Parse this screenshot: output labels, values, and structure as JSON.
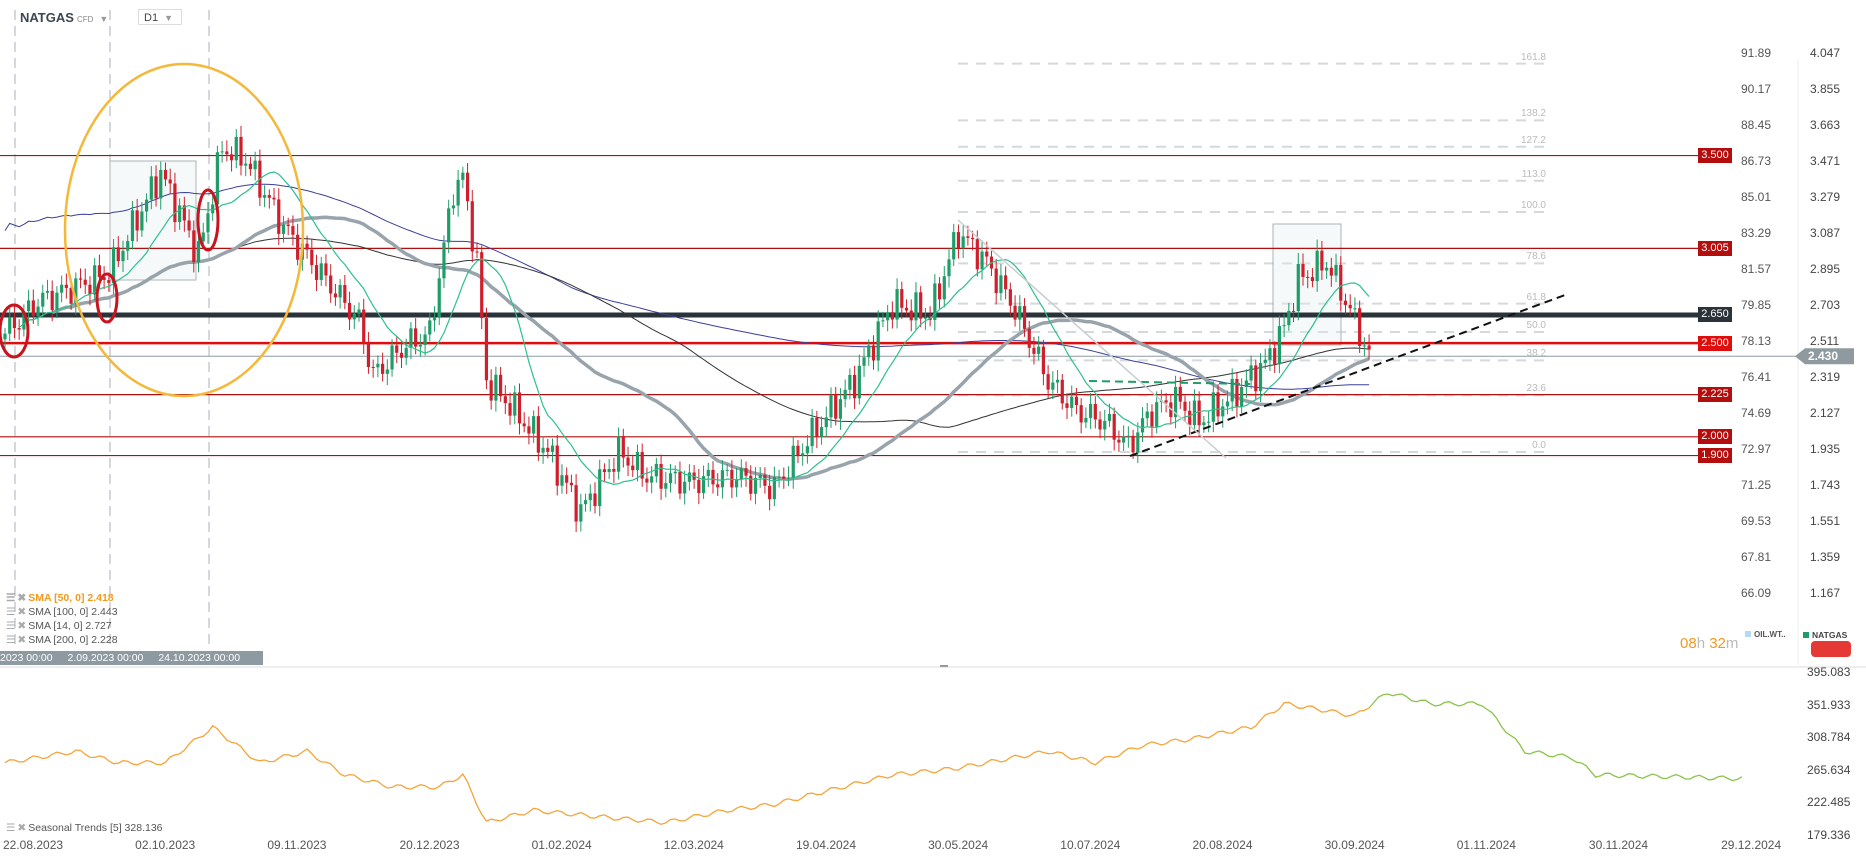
{
  "header": {
    "symbol": "NATGAS",
    "symbol_type": "CFD",
    "timeframe": "D1"
  },
  "colors": {
    "up": "#1f9c68",
    "down": "#d01f2c",
    "level_red": "#b30d0d",
    "level_2500": "#e00d0d",
    "level_2650": "#2a333a",
    "sma14": "#2cc08c",
    "sma50": "#98a3ab",
    "sma100": "#333333",
    "sma200": "#3b3f9a",
    "seasonal_past": "#f5a43a",
    "seasonal_future": "#8bc34a",
    "ellipse": "#f4b83a"
  },
  "indicators": [
    {
      "label": "SMA [50, 0] 2.418",
      "highlight": true
    },
    {
      "label": "SMA [100, 0] 2.443"
    },
    {
      "label": "SMA [14, 0] 2.727"
    },
    {
      "label": "SMA [200, 0] 2.228"
    }
  ],
  "crosshair_dates": [
    "2023 00:00",
    "2.09.2023 00:00",
    "24.10.2023 00:00"
  ],
  "timer": {
    "hours": "08",
    "h": "h",
    "minutes": "32",
    "m": "m"
  },
  "series_legend": [
    {
      "label": "OIL.WT..",
      "color": "#b3dcf2"
    },
    {
      "label": "NATGAS",
      "color": "#1f9c68"
    }
  ],
  "seasonal_label": "Seasonal  Trends  [5]  328.136",
  "chart_data": {
    "type": "candlestick",
    "title": "NATGAS CFD D1",
    "x_ticks": [
      "22.08.2023",
      "02.10.2023",
      "09.11.2023",
      "20.12.2023",
      "01.02.2024",
      "12.03.2024",
      "19.04.2024",
      "30.05.2024",
      "10.07.2024",
      "20.08.2024",
      "30.09.2024",
      "01.11.2024",
      "30.11.2024",
      "29.12.2024"
    ],
    "bars_per_tick": 28,
    "right_axis": {
      "ticks": [
        "4.047",
        "3.855",
        "3.663",
        "3.471",
        "3.279",
        "3.087",
        "2.895",
        "2.703",
        "2.511",
        "2.319",
        "2.127",
        "1.935",
        "1.743",
        "1.551",
        "1.359",
        "1.167"
      ],
      "range": [
        1.167,
        4.047
      ]
    },
    "left_axis": {
      "name": "OIL.WT..",
      "ticks": [
        "91.89",
        "90.17",
        "88.45",
        "86.73",
        "85.01",
        "83.29",
        "81.57",
        "79.85",
        "78.13",
        "76.41",
        "74.69",
        "72.97",
        "71.25",
        "69.53",
        "67.81",
        "66.09"
      ]
    },
    "last_price": "2.430",
    "price_levels": [
      {
        "label": "3.500",
        "value": 3.5,
        "kind": "red"
      },
      {
        "label": "3.005",
        "value": 3.005,
        "kind": "red"
      },
      {
        "label": "2.650",
        "value": 2.65,
        "kind": "dark"
      },
      {
        "label": "2.500",
        "value": 2.5,
        "kind": "bright"
      },
      {
        "label": "2.225",
        "value": 2.225,
        "kind": "red"
      },
      {
        "label": "2.000",
        "value": 2.0,
        "kind": "red"
      },
      {
        "label": "1.900",
        "value": 1.9,
        "kind": "red"
      }
    ],
    "fibonacci": {
      "from": 1.919,
      "to": 3.2,
      "levels": [
        "0.0",
        "23.6",
        "38.2",
        "50.0",
        "61.8",
        "78.6",
        "100.0",
        "113.0",
        "127.2",
        "138.2",
        "161.8"
      ]
    },
    "close_keypoints": [
      [
        0,
        2.55
      ],
      [
        7,
        2.72
      ],
      [
        22,
        2.87
      ],
      [
        33,
        3.41
      ],
      [
        41,
        2.97
      ],
      [
        46,
        3.54
      ],
      [
        51,
        3.48
      ],
      [
        59,
        3.12
      ],
      [
        65,
        2.93
      ],
      [
        75,
        2.62
      ],
      [
        78,
        2.33
      ],
      [
        85,
        2.49
      ],
      [
        90,
        2.55
      ],
      [
        95,
        3.32
      ],
      [
        97,
        3.38
      ],
      [
        100,
        2.93
      ],
      [
        102,
        2.3
      ],
      [
        107,
        2.17
      ],
      [
        115,
        1.92
      ],
      [
        122,
        1.6
      ],
      [
        130,
        1.92
      ],
      [
        136,
        1.79
      ],
      [
        145,
        1.76
      ],
      [
        155,
        1.79
      ],
      [
        163,
        1.73
      ],
      [
        170,
        1.98
      ],
      [
        180,
        2.3
      ],
      [
        188,
        2.71
      ],
      [
        196,
        2.65
      ],
      [
        202,
        3.09
      ],
      [
        208,
        2.93
      ],
      [
        214,
        2.68
      ],
      [
        221,
        2.3
      ],
      [
        227,
        2.14
      ],
      [
        233,
        2.08
      ],
      [
        238,
        1.95
      ],
      [
        243,
        2.14
      ],
      [
        248,
        2.2
      ],
      [
        253,
        2.08
      ],
      [
        261,
        2.24
      ],
      [
        267,
        2.39
      ],
      [
        271,
        2.58
      ],
      [
        274,
        2.84
      ],
      [
        280,
        2.93
      ],
      [
        283,
        2.78
      ],
      [
        286,
        2.62
      ],
      [
        289,
        2.43
      ]
    ],
    "seasonal": {
      "ticks": [
        "395.083",
        "351.933",
        "308.784",
        "265.634",
        "222.485",
        "179.336"
      ],
      "range": [
        179.336,
        395.083
      ],
      "keypoints": [
        [
          0,
          275
        ],
        [
          15,
          290
        ],
        [
          24,
          275
        ],
        [
          34,
          275
        ],
        [
          44,
          322
        ],
        [
          54,
          275
        ],
        [
          64,
          290
        ],
        [
          72,
          259
        ],
        [
          82,
          243
        ],
        [
          92,
          243
        ],
        [
          97,
          259
        ],
        [
          102,
          196
        ],
        [
          112,
          212
        ],
        [
          125,
          204
        ],
        [
          140,
          196
        ],
        [
          153,
          212
        ],
        [
          163,
          220
        ],
        [
          173,
          236
        ],
        [
          188,
          259
        ],
        [
          201,
          267
        ],
        [
          221,
          290
        ],
        [
          231,
          275
        ],
        [
          241,
          298
        ],
        [
          251,
          306
        ],
        [
          264,
          322
        ],
        [
          271,
          353
        ],
        [
          279,
          345
        ],
        [
          286,
          337
        ],
        [
          293,
          368
        ],
        [
          302,
          353
        ],
        [
          313,
          353
        ],
        [
          322,
          290
        ],
        [
          332,
          282
        ],
        [
          337,
          259
        ],
        [
          368,
          254
        ]
      ],
      "future_from_bar": 289
    }
  }
}
